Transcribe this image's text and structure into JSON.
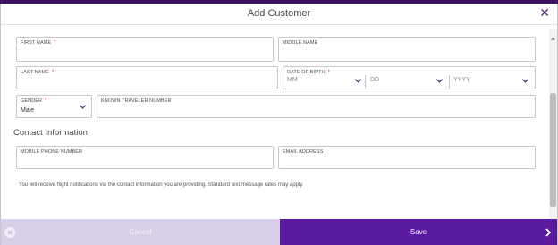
{
  "modal": {
    "title": "Add Customer",
    "close_icon": "close-icon",
    "accent_color": "#5a1aa0"
  },
  "fields": {
    "first_name": {
      "label": "FIRST NAME",
      "required": "*",
      "value": ""
    },
    "middle_name": {
      "label": "MIDDLE NAME",
      "value": ""
    },
    "last_name": {
      "label": "LAST NAME",
      "required": "*",
      "value": ""
    },
    "date_of_birth": {
      "label": "DATE OF BIRTH",
      "required": "*",
      "month_placeholder": "MM",
      "day_placeholder": "DD",
      "year_placeholder": "YYYY"
    },
    "gender": {
      "label": "GENDER",
      "required": "*",
      "value": "Male"
    },
    "known_traveler_number": {
      "label": "KNOWN TRAVELER NUMBER",
      "value": ""
    }
  },
  "contact": {
    "section_title": "Contact Information",
    "mobile_phone": {
      "label": "MOBILE PHONE NUMBER",
      "value": ""
    },
    "email": {
      "label": "EMAIL ADDRESS",
      "value": ""
    },
    "notice": "You will receive flight notifications via the contact information you are providing. Standard text message rates may apply."
  },
  "footer": {
    "cancel_label": "Cancel",
    "save_label": "Save"
  }
}
